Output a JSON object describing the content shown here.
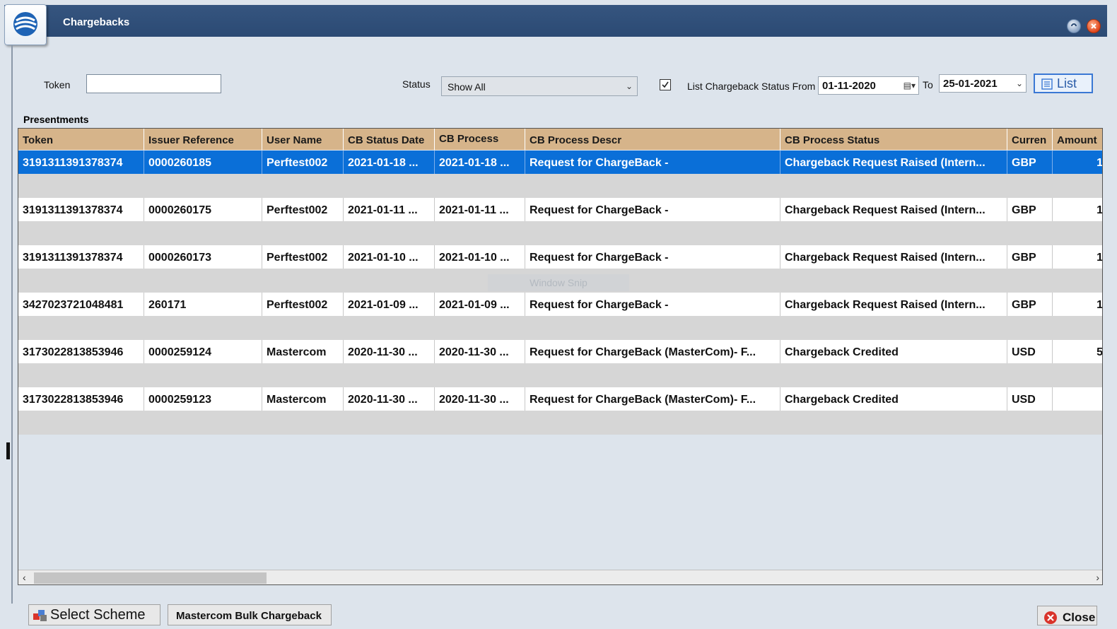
{
  "window": {
    "title": "Chargebacks"
  },
  "filters": {
    "token_label": "Token",
    "token_value": "",
    "status_label": "Status",
    "status_value": "Show All",
    "list_from_label": "List Chargeback Status From",
    "list_from_checked": true,
    "from_date": "01-11-2020",
    "to_label": "To",
    "to_date": "25-01-2021",
    "list_button": "List"
  },
  "grid": {
    "section_title": "Presentments",
    "columns": [
      "Token",
      "Issuer Reference",
      "User Name",
      "CB Status Date",
      "CB Process",
      "CB Process Descr",
      "CB Process Status",
      "Curren",
      "Amount"
    ],
    "rows": [
      [
        "3191311391378374",
        "0000260185",
        "Perftest002",
        "2021-01-18 ...",
        "2021-01-18 ...",
        "Request for ChargeBack -",
        "Chargeback Request Raised (Intern...",
        "GBP",
        "1"
      ],
      [
        "3191311391378374",
        "0000260175",
        "Perftest002",
        "2021-01-11 ...",
        "2021-01-11 ...",
        "Request for ChargeBack -",
        "Chargeback Request Raised (Intern...",
        "GBP",
        "1"
      ],
      [
        "3191311391378374",
        "0000260173",
        "Perftest002",
        "2021-01-10 ...",
        "2021-01-10 ...",
        "Request for ChargeBack -",
        "Chargeback Request Raised (Intern...",
        "GBP",
        "1"
      ],
      [
        "3427023721048481",
        "260171",
        "Perftest002",
        "2021-01-09 ...",
        "2021-01-09 ...",
        "Request for ChargeBack -",
        "Chargeback Request Raised (Intern...",
        "GBP",
        "1"
      ],
      [
        "3173022813853946",
        "0000259124",
        "Mastercom",
        "2020-11-30 ...",
        "2020-11-30 ...",
        "Request for ChargeBack (MasterCom)- F...",
        "Chargeback Credited",
        "USD",
        "5"
      ],
      [
        "3173022813853946",
        "0000259123",
        "Mastercom",
        "2020-11-30 ...",
        "2020-11-30 ...",
        "Request for ChargeBack (MasterCom)- F...",
        "Chargeback Credited",
        "USD",
        ""
      ]
    ],
    "watermark": "Window Snip"
  },
  "footer": {
    "select_scheme": "Select Scheme",
    "bulk_chargeback": "Mastercom Bulk Chargeback",
    "close": "Close"
  },
  "colors": {
    "titlebar": "#2b4a74",
    "header": "#d6b48a",
    "selected_row": "#0a6fd8",
    "gap_row": "#d6d6d6"
  }
}
